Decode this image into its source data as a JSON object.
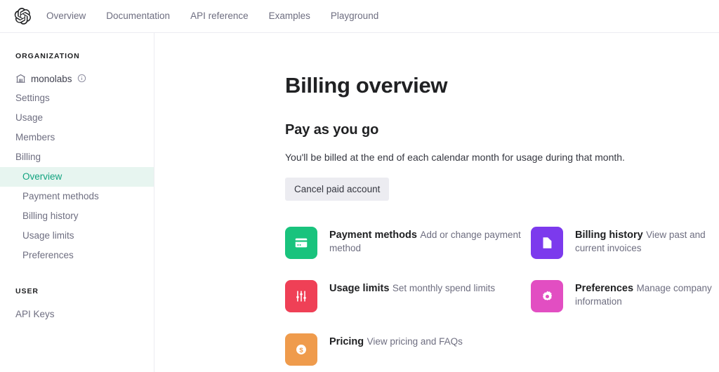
{
  "header": {
    "logo_icon": "openai-logo-icon",
    "nav": [
      {
        "label": "Overview"
      },
      {
        "label": "Documentation"
      },
      {
        "label": "API reference"
      },
      {
        "label": "Examples"
      },
      {
        "label": "Playground"
      }
    ]
  },
  "sidebar": {
    "org_section_title": "ORGANIZATION",
    "org_name": "monolabs",
    "org_icon": "bank-building-icon",
    "org_info_icon": "info-circle-icon",
    "org_items": [
      {
        "label": "Settings",
        "active": false
      },
      {
        "label": "Usage",
        "active": false
      },
      {
        "label": "Members",
        "active": false
      },
      {
        "label": "Billing",
        "active": false
      }
    ],
    "billing_items": [
      {
        "label": "Overview",
        "active": true
      },
      {
        "label": "Payment methods",
        "active": false
      },
      {
        "label": "Billing history",
        "active": false
      },
      {
        "label": "Usage limits",
        "active": false
      },
      {
        "label": "Preferences",
        "active": false
      }
    ],
    "user_section_title": "USER",
    "user_items": [
      {
        "label": "API Keys",
        "active": false
      }
    ],
    "active_bg": "#e7f5f0",
    "active_color": "#10a37f"
  },
  "main": {
    "page_title": "Billing overview",
    "section_title": "Pay as you go",
    "section_desc": "You'll be billed at the end of each calendar month for usage during that month.",
    "cancel_button": "Cancel paid account",
    "tiles": [
      {
        "title": "Payment methods",
        "subtitle": "Add or change payment method",
        "icon": "credit-card-icon",
        "color": "#19c37d"
      },
      {
        "title": "Billing history",
        "subtitle": "View past and current invoices",
        "icon": "document-icon",
        "color": "#7c3aed"
      },
      {
        "title": "Usage limits",
        "subtitle": "Set monthly spend limits",
        "icon": "sliders-icon",
        "color": "#ef4056"
      },
      {
        "title": "Preferences",
        "subtitle": "Manage company information",
        "icon": "gear-icon",
        "color": "#e24ec2"
      },
      {
        "title": "Pricing",
        "subtitle": "View pricing and FAQs",
        "icon": "dollar-circle-icon",
        "color": "#ef9b4c"
      }
    ]
  }
}
